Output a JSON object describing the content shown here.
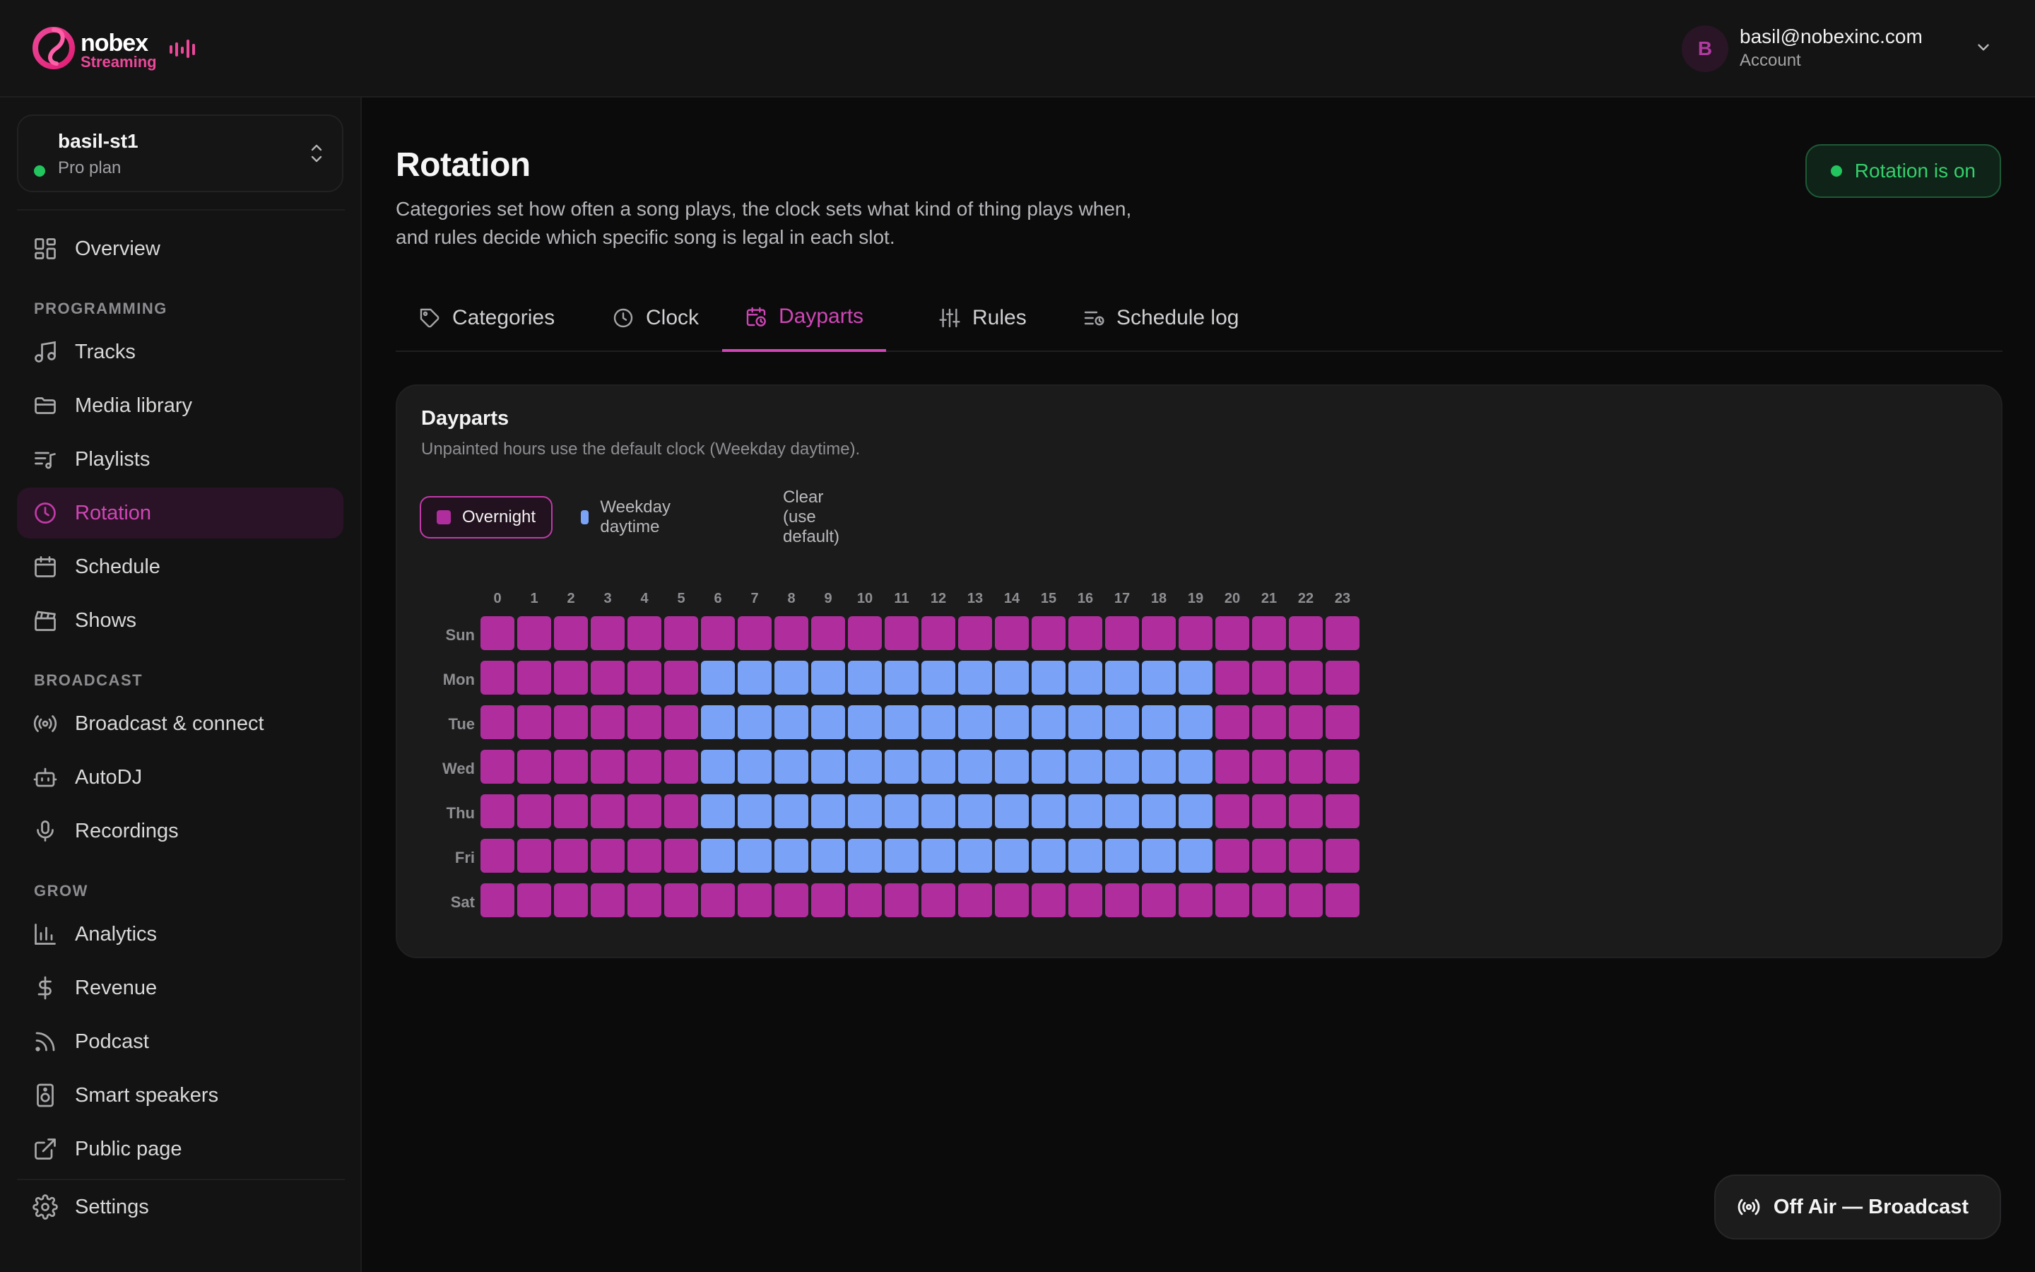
{
  "brand": {
    "name": "nobex",
    "sub": "Streaming",
    "accent": "#ec4899"
  },
  "account": {
    "initial": "B",
    "email": "basil@nobexinc.com",
    "label": "Account"
  },
  "station": {
    "name": "basil-st1",
    "plan": "Pro plan",
    "status_color": "#22c55e"
  },
  "sidebar": {
    "overview": "Overview",
    "sections": {
      "programming": "PROGRAMMING",
      "broadcast": "BROADCAST",
      "grow": "GROW"
    },
    "items": [
      {
        "id": "overview",
        "label": "Overview",
        "icon": "grid-icon"
      },
      {
        "id": "tracks",
        "label": "Tracks",
        "icon": "music-note-icon"
      },
      {
        "id": "media-library",
        "label": "Media library",
        "icon": "folder-icon"
      },
      {
        "id": "playlists",
        "label": "Playlists",
        "icon": "playlist-icon"
      },
      {
        "id": "rotation",
        "label": "Rotation",
        "icon": "clock-icon",
        "active": true
      },
      {
        "id": "schedule",
        "label": "Schedule",
        "icon": "calendar-icon"
      },
      {
        "id": "shows",
        "label": "Shows",
        "icon": "clapperboard-icon"
      },
      {
        "id": "broadcast-connect",
        "label": "Broadcast & connect",
        "icon": "radio-waves-icon"
      },
      {
        "id": "autodj",
        "label": "AutoDJ",
        "icon": "robot-icon"
      },
      {
        "id": "recordings",
        "label": "Recordings",
        "icon": "microphone-icon"
      },
      {
        "id": "analytics",
        "label": "Analytics",
        "icon": "bar-chart-icon"
      },
      {
        "id": "revenue",
        "label": "Revenue",
        "icon": "dollar-icon"
      },
      {
        "id": "podcast",
        "label": "Podcast",
        "icon": "rss-icon"
      },
      {
        "id": "smart-speakers",
        "label": "Smart speakers",
        "icon": "speaker-icon"
      },
      {
        "id": "public-page",
        "label": "Public page",
        "icon": "external-link-icon"
      },
      {
        "id": "settings",
        "label": "Settings",
        "icon": "gear-icon"
      }
    ]
  },
  "page": {
    "title": "Rotation",
    "description": "Categories set how often a song plays, the clock sets what kind of thing plays when, and rules decide which specific song is legal in each slot.",
    "status": "Rotation is on",
    "status_color": "#22c55e"
  },
  "tabs": [
    {
      "label": "Categories",
      "icon": "tag-icon"
    },
    {
      "label": "Clock",
      "icon": "clock-icon"
    },
    {
      "label": "Dayparts",
      "icon": "calendar-clock-icon",
      "active": true
    },
    {
      "label": "Rules",
      "icon": "sliders-icon"
    },
    {
      "label": "Schedule log",
      "icon": "list-icon"
    }
  ],
  "dayparts": {
    "title": "Dayparts",
    "subtitle": "Unpainted hours use the default clock (Weekday daytime).",
    "brushes": [
      {
        "label": "Overnight",
        "color": "#b02d9e",
        "active": true
      },
      {
        "label": "Weekday daytime",
        "color": "#7aa2f7",
        "active": false
      },
      {
        "label": "Clear (use default)",
        "color": null,
        "active": false
      }
    ],
    "hours": [
      "0",
      "1",
      "2",
      "3",
      "4",
      "5",
      "6",
      "7",
      "8",
      "9",
      "10",
      "11",
      "12",
      "13",
      "14",
      "15",
      "16",
      "17",
      "18",
      "19",
      "20",
      "21",
      "22",
      "23"
    ],
    "days": [
      "Sun",
      "Mon",
      "Tue",
      "Wed",
      "Thu",
      "Fri",
      "Sat"
    ],
    "colors": {
      "O": "#b02d9e",
      "W": "#7aa2f7"
    },
    "grid": [
      "OOOOOOOOOOOOOOOOOOOOOOOO",
      "OOOOOOWWWWWWWWWWWWWWOOOO",
      "OOOOOOWWWWWWWWWWWWWWOOOO",
      "OOOOOOWWWWWWWWWWWWWWOOOO",
      "OOOOOOWWWWWWWWWWWWWWOOOO",
      "OOOOOOWWWWWWWWWWWWWWOOOO",
      "OOOOOOOOOOOOOOOOOOOOOOOO"
    ]
  },
  "fab": {
    "label": "Off Air — Broadcast",
    "icon": "broadcast-icon"
  }
}
